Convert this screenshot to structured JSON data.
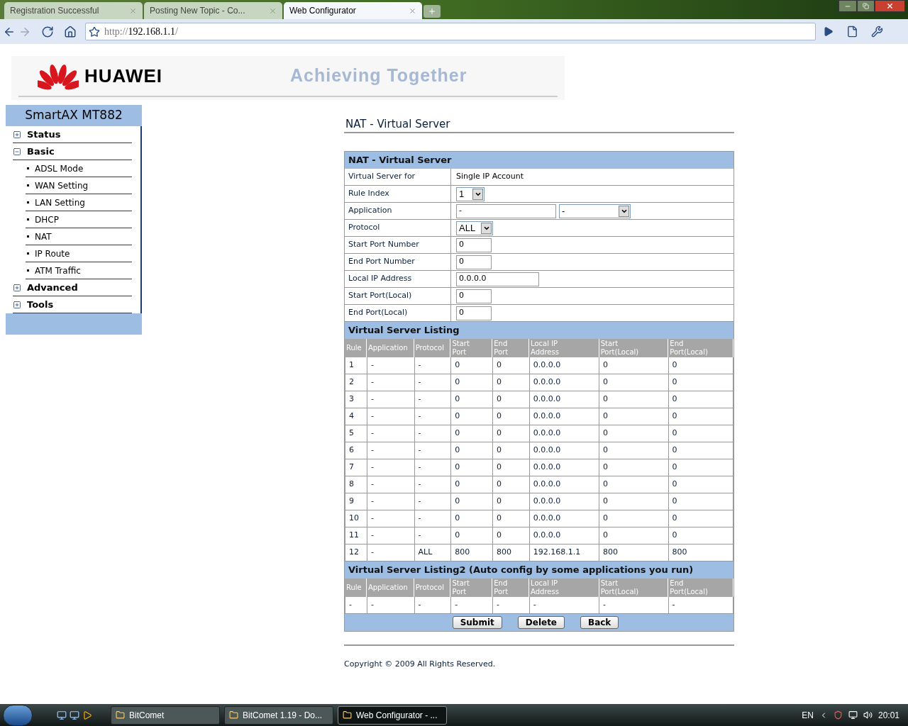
{
  "browser": {
    "tabs": [
      {
        "title": "Registration Successful",
        "selected": false
      },
      {
        "title": "Posting New Topic - Co...",
        "selected": false
      },
      {
        "title": "Web Configurator",
        "selected": true
      }
    ],
    "address": {
      "scheme": "http://",
      "host": "192.168.1.1",
      "path": "/"
    }
  },
  "header": {
    "logo_text": "HUAWEI",
    "slogan": "Achieving Together"
  },
  "sidebar": {
    "title": "SmartAX MT882",
    "items": [
      {
        "label": "Status",
        "expanded": false
      },
      {
        "label": "Basic",
        "expanded": true,
        "children": [
          {
            "label": "ADSL Mode"
          },
          {
            "label": "WAN Setting"
          },
          {
            "label": "LAN Setting"
          },
          {
            "label": "DHCP"
          },
          {
            "label": "NAT"
          },
          {
            "label": "IP Route"
          },
          {
            "label": "ATM Traffic"
          }
        ]
      },
      {
        "label": "Advanced",
        "expanded": false
      },
      {
        "label": "Tools",
        "expanded": false
      }
    ]
  },
  "page_title": "NAT - Virtual Server",
  "form": {
    "title": "NAT - Virtual Server",
    "rows": [
      {
        "label": "Virtual Server for",
        "kind": "text",
        "value": "Single IP Account"
      },
      {
        "label": "Rule Index",
        "kind": "select",
        "value": "1"
      },
      {
        "label": "Application",
        "kind": "input_select",
        "value": "-",
        "select_value": "-"
      },
      {
        "label": "Protocol",
        "kind": "select",
        "value": "ALL"
      },
      {
        "label": "Start Port Number",
        "kind": "input",
        "value": "0"
      },
      {
        "label": "End Port Number",
        "kind": "input",
        "value": "0"
      },
      {
        "label": "Local IP Address",
        "kind": "wide_input",
        "value": "0.0.0.0"
      },
      {
        "label": "Start Port(Local)",
        "kind": "input",
        "value": "0"
      },
      {
        "label": "End Port(Local)",
        "kind": "input",
        "value": "0"
      }
    ]
  },
  "listing": {
    "title": "Virtual Server Listing",
    "columns": [
      "Rule",
      "Application",
      "Protocol",
      "Start\nPort",
      "End\nPort",
      "Local IP\nAddress",
      "Start\nPort(Local)",
      "End\nPort(Local)"
    ],
    "rows": [
      [
        "1",
        "-",
        "-",
        "0",
        "0",
        "0.0.0.0",
        "0",
        "0"
      ],
      [
        "2",
        "-",
        "-",
        "0",
        "0",
        "0.0.0.0",
        "0",
        "0"
      ],
      [
        "3",
        "-",
        "-",
        "0",
        "0",
        "0.0.0.0",
        "0",
        "0"
      ],
      [
        "4",
        "-",
        "-",
        "0",
        "0",
        "0.0.0.0",
        "0",
        "0"
      ],
      [
        "5",
        "-",
        "-",
        "0",
        "0",
        "0.0.0.0",
        "0",
        "0"
      ],
      [
        "6",
        "-",
        "-",
        "0",
        "0",
        "0.0.0.0",
        "0",
        "0"
      ],
      [
        "7",
        "-",
        "-",
        "0",
        "0",
        "0.0.0.0",
        "0",
        "0"
      ],
      [
        "8",
        "-",
        "-",
        "0",
        "0",
        "0.0.0.0",
        "0",
        "0"
      ],
      [
        "9",
        "-",
        "-",
        "0",
        "0",
        "0.0.0.0",
        "0",
        "0"
      ],
      [
        "10",
        "-",
        "-",
        "0",
        "0",
        "0.0.0.0",
        "0",
        "0"
      ],
      [
        "11",
        "-",
        "-",
        "0",
        "0",
        "0.0.0.0",
        "0",
        "0"
      ],
      [
        "12",
        "-",
        "ALL",
        "800",
        "800",
        "192.168.1.1",
        "800",
        "800"
      ]
    ]
  },
  "listing2": {
    "title": "Virtual Server Listing2 (Auto config by some applications you run)",
    "columns": [
      "Rule",
      "Application",
      "Protocol",
      "Start\nPort",
      "End\nPort",
      "Local IP\nAddress",
      "Start\nPort(Local)",
      "End\nPort(Local)"
    ],
    "rows": [
      [
        "-",
        "-",
        "-",
        "-",
        "-",
        "-",
        "-",
        "-"
      ]
    ]
  },
  "buttons": [
    "Submit",
    "Delete",
    "Back"
  ],
  "copyright": "Copyright © 2009 All Rights Reserved.",
  "taskbar": {
    "items": [
      {
        "label": "BitComet",
        "selected": false
      },
      {
        "label": "BitComet 1.19 - Do...",
        "selected": false
      },
      {
        "label": "Web Configurator - ...",
        "selected": true
      }
    ],
    "language": "EN",
    "clock": "20:01"
  }
}
